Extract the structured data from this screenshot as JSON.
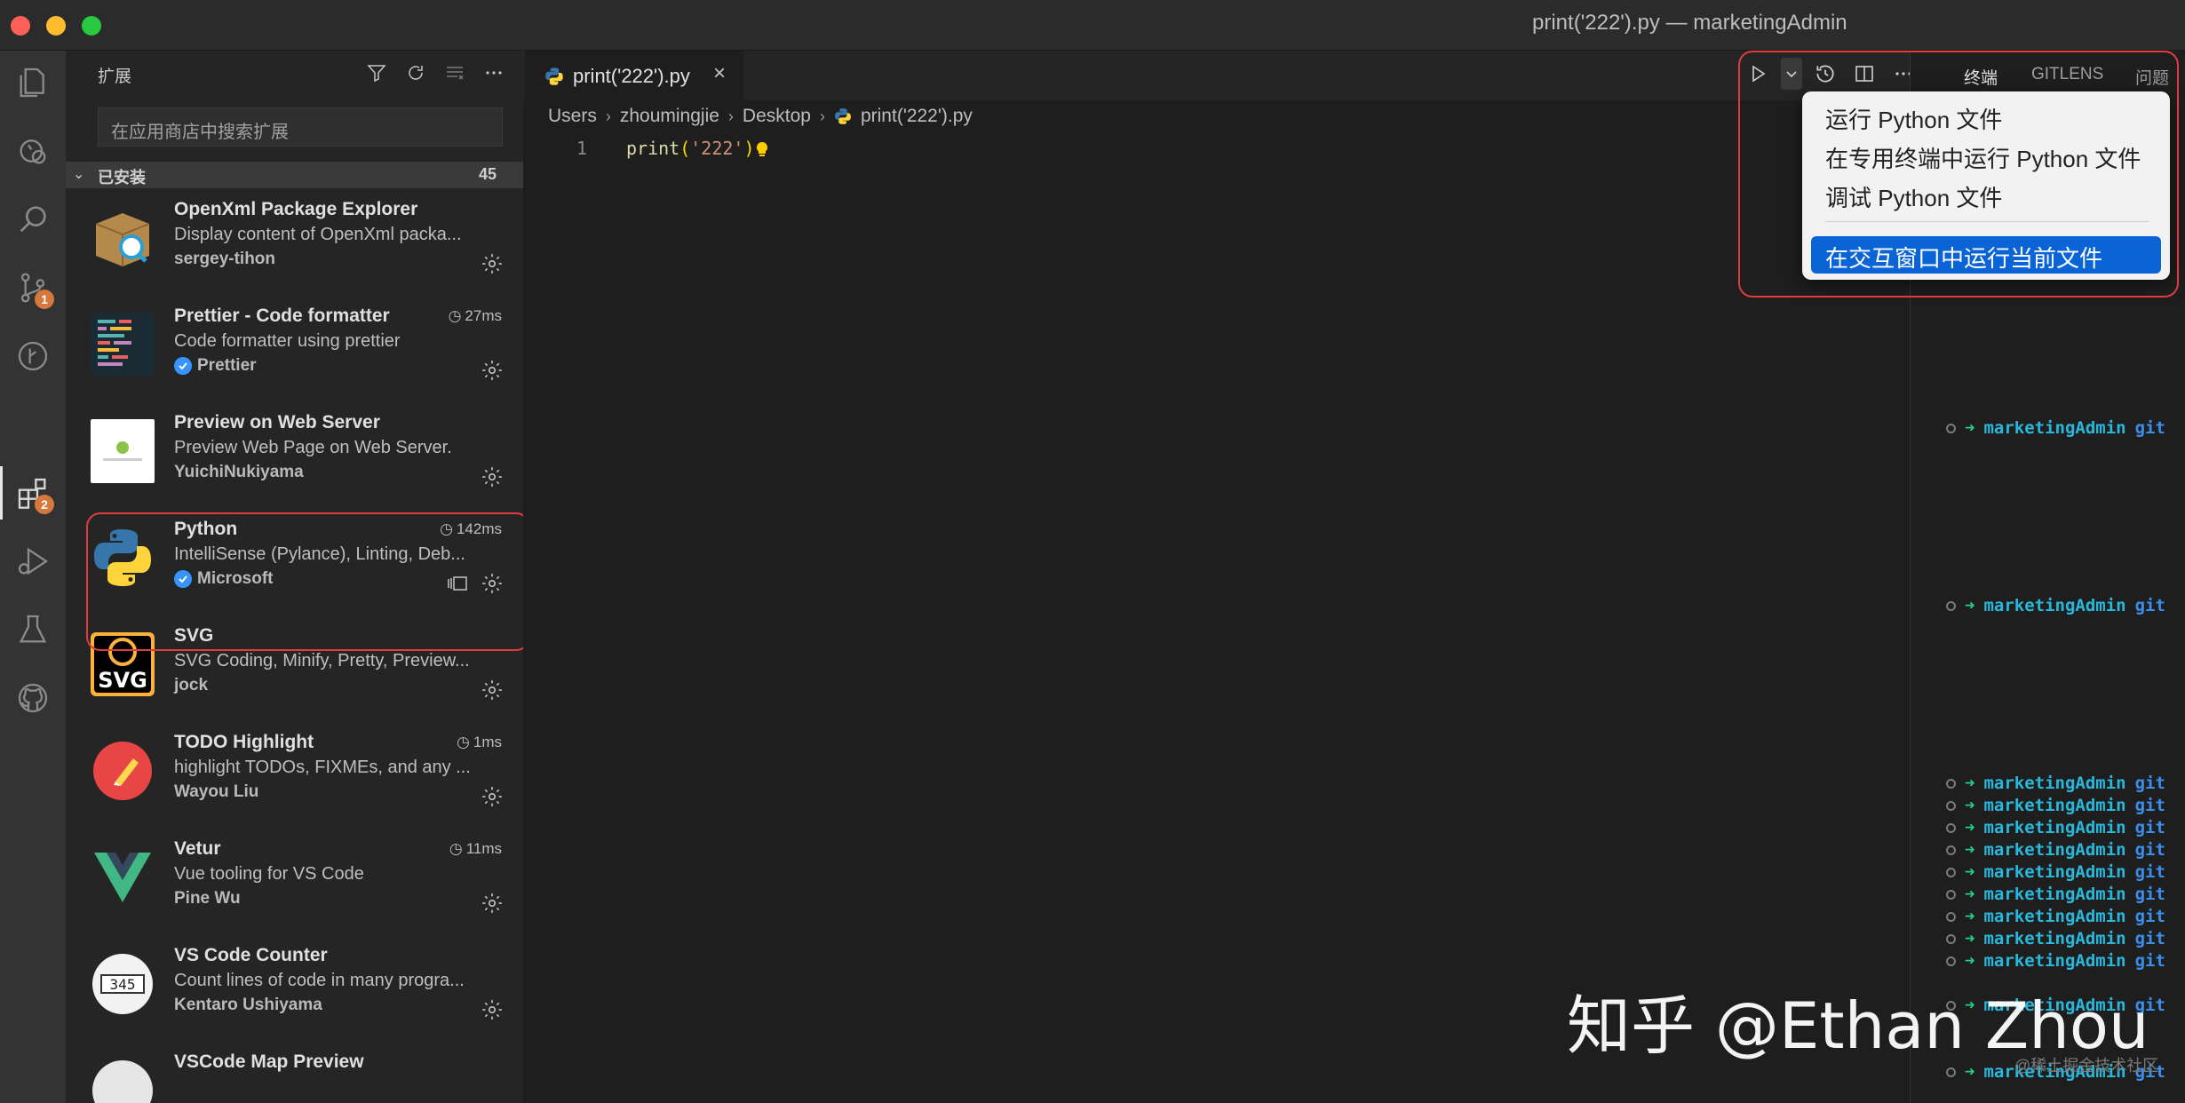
{
  "window": {
    "title": "print('222').py — marketingAdmin"
  },
  "activity_bar": {
    "items": [
      {
        "name": "explorer",
        "badge": ""
      },
      {
        "name": "remote",
        "badge": ""
      },
      {
        "name": "search",
        "badge": ""
      },
      {
        "name": "source-control",
        "badge": "1"
      },
      {
        "name": "git-graph",
        "badge": ""
      },
      {
        "name": "extensions",
        "badge": "2"
      },
      {
        "name": "run-debug",
        "badge": ""
      },
      {
        "name": "testing",
        "badge": ""
      },
      {
        "name": "github",
        "badge": ""
      }
    ]
  },
  "sidebar": {
    "title": "扩展",
    "search_placeholder": "在应用商店中搜索扩展",
    "section": {
      "label": "已安装",
      "count": "45"
    },
    "extensions": [
      {
        "name": "OpenXml Package Explorer",
        "desc": "Display content of OpenXml packa...",
        "publisher": "sergey-tihon",
        "verified": false,
        "time": ""
      },
      {
        "name": "Prettier - Code formatter",
        "desc": "Code formatter using prettier",
        "publisher": "Prettier",
        "verified": true,
        "time": "27ms"
      },
      {
        "name": "Preview on Web Server",
        "desc": "Preview Web Page on Web Server.",
        "publisher": "YuichiNukiyama",
        "verified": false,
        "time": ""
      },
      {
        "name": "Python",
        "desc": "IntelliSense (Pylance), Linting, Deb...",
        "publisher": "Microsoft",
        "verified": true,
        "time": "142ms"
      },
      {
        "name": "SVG",
        "desc": "SVG Coding, Minify, Pretty, Preview...",
        "publisher": "jock",
        "verified": false,
        "time": ""
      },
      {
        "name": "TODO Highlight",
        "desc": "highlight TODOs, FIXMEs, and any ...",
        "publisher": "Wayou Liu",
        "verified": false,
        "time": "1ms"
      },
      {
        "name": "Vetur",
        "desc": "Vue tooling for VS Code",
        "publisher": "Pine Wu",
        "verified": false,
        "time": "11ms"
      },
      {
        "name": "VS Code Counter",
        "desc": "Count lines of code in many progra...",
        "publisher": "Kentaro Ushiyama",
        "verified": false,
        "time": ""
      },
      {
        "name": "VSCode Map Preview",
        "desc": "",
        "publisher": "",
        "verified": false,
        "time": ""
      }
    ]
  },
  "editor": {
    "tab": {
      "label": "print('222').py"
    },
    "breadcrumb": [
      "Users",
      "zhoumingjie",
      "Desktop",
      "print('222').py"
    ],
    "line_number": "1",
    "code": {
      "fn": "print",
      "open": "(",
      "str": "'222'",
      "close": ")"
    }
  },
  "run_menu": {
    "items": [
      "运行 Python 文件",
      "在专用终端中运行 Python 文件",
      "调试 Python 文件"
    ],
    "highlighted": "在交互窗口中运行当前文件"
  },
  "panel": {
    "tabs": [
      "终端",
      "GITLENS",
      "问题"
    ],
    "prompt_name": "marketingAdmin",
    "prompt_git": "git"
  },
  "watermark": {
    "main": "知乎 @Ethan Zhou",
    "sub": "@稀土掘金技术社区"
  },
  "colors": {
    "accent": "#0a64d6",
    "highlight_box": "#e03c3c",
    "badge": "#d6783b"
  }
}
